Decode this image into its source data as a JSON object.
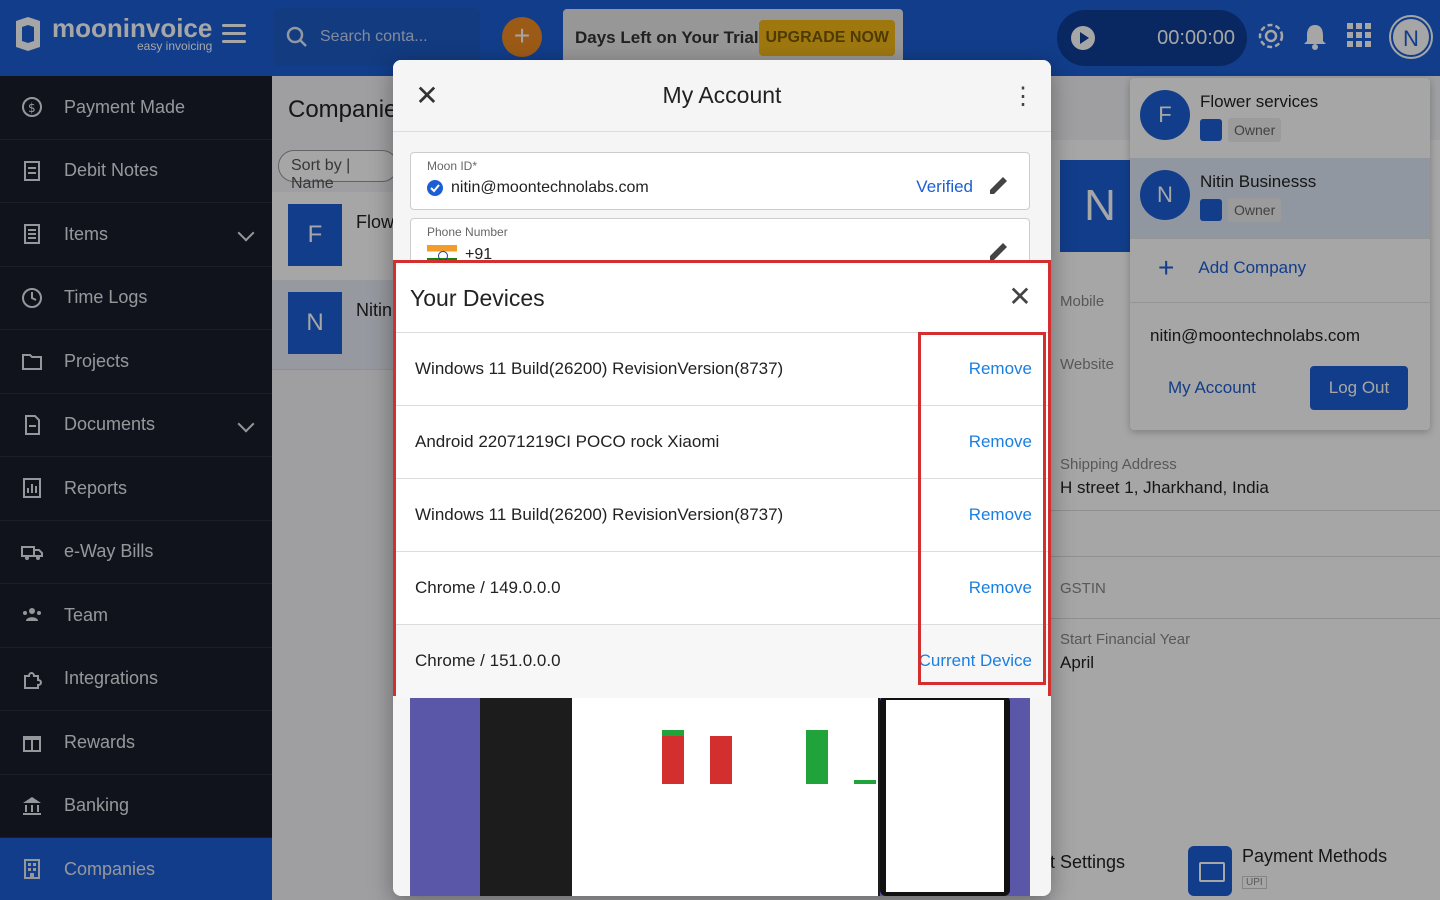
{
  "topbar": {
    "brand_name": "mooninvoice",
    "brand_sub": "easy invoicing",
    "search_placeholder": "Search conta...",
    "trial_text": "Days Left on Your Trial",
    "upgrade_label": "UPGRADE NOW",
    "timer": "00:00:00",
    "avatar_initial": "N"
  },
  "sidebar": {
    "items": [
      {
        "label": "Payment Made",
        "icon": "payment-icon"
      },
      {
        "label": "Debit Notes",
        "icon": "debit-note-icon"
      },
      {
        "label": "Items",
        "icon": "items-icon",
        "expandable": true
      },
      {
        "label": "Time Logs",
        "icon": "clock-icon"
      },
      {
        "label": "Projects",
        "icon": "folder-icon"
      },
      {
        "label": "Documents",
        "icon": "document-icon",
        "expandable": true
      },
      {
        "label": "Reports",
        "icon": "reports-icon"
      },
      {
        "label": "e-Way Bills",
        "icon": "truck-icon"
      },
      {
        "label": "Team",
        "icon": "team-icon"
      },
      {
        "label": "Integrations",
        "icon": "puzzle-icon"
      },
      {
        "label": "Rewards",
        "icon": "gift-icon"
      },
      {
        "label": "Banking",
        "icon": "bank-icon"
      },
      {
        "label": "Companies",
        "icon": "building-icon",
        "active": true
      }
    ]
  },
  "background": {
    "page_title": "Companies",
    "sort_label": "Sort by | Name",
    "companies": [
      {
        "initial": "F",
        "name": "Flowe"
      },
      {
        "initial": "N",
        "name": "Nitin"
      }
    ],
    "detail_initial": "N",
    "labels": {
      "mobile": "Mobile",
      "website": "Website",
      "shipping": "Shipping Address",
      "shipping_value": "H street 1, Jharkhand, India",
      "gstin": "GSTIN",
      "fin_year": "Start Financial Year",
      "fin_year_value": "April"
    },
    "settings_card": "t Settings",
    "payment_methods": "Payment Methods",
    "payment_sub": "UPI"
  },
  "account_dropdown": {
    "companies": [
      {
        "initial": "F",
        "name": "Flower services",
        "role": "Owner"
      },
      {
        "initial": "N",
        "name": "Nitin Businesss",
        "role": "Owner",
        "selected": true
      }
    ],
    "add_company": "Add Company",
    "email": "nitin@moontechnolabs.com",
    "my_account": "My Account",
    "logout": "Log Out"
  },
  "my_account_modal": {
    "title": "My Account",
    "moon_id_label": "Moon ID*",
    "moon_id_value": "nitin@moontechnolabs.com",
    "verified": "Verified",
    "phone_label": "Phone Number",
    "phone_code": "+91"
  },
  "devices_dialog": {
    "title": "Your Devices",
    "devices": [
      {
        "name": "Windows 11 Build(26200) RevisionVersion(8737)",
        "action": "Remove"
      },
      {
        "name": "Android 22071219CI POCO rock Xiaomi",
        "action": "Remove"
      },
      {
        "name": "Windows 11 Build(26200) RevisionVersion(8737)",
        "action": "Remove"
      },
      {
        "name": "Chrome / 149.0.0.0",
        "action": "Remove"
      },
      {
        "name": "Chrome / 151.0.0.0",
        "action": "Current Device",
        "current": true
      }
    ]
  },
  "colors": {
    "brand_blue": "#1b5fd4",
    "sidebar_bg": "#1a1e2b",
    "highlight_red": "#d32f2f",
    "link_blue": "#1b7fe0",
    "upgrade_yellow": "#f3b918"
  }
}
